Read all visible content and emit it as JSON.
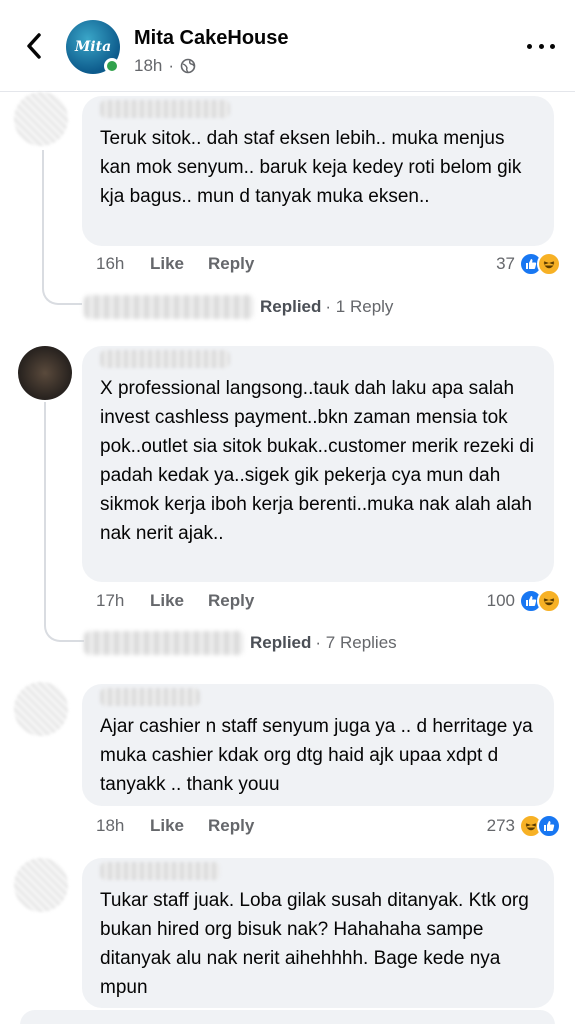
{
  "header": {
    "page_name": "Mita CakeHouse",
    "time": "18h",
    "logo_text": "Mita"
  },
  "comments": [
    {
      "text": "Teruk sitok.. dah staf eksen lebih.. muka menjus kan mok senyum.. baruk keja kedey roti belom gik kja bagus.. mun d tanyak muka eksen..",
      "time": "16h",
      "like": "Like",
      "reply": "Reply",
      "reactions": "37",
      "reaction_icons": [
        "like-icon",
        "haha-icon"
      ],
      "replied_label": "Replied",
      "replied_count": "· 1 Reply"
    },
    {
      "text": "X professional langsong..tauk dah laku apa salah invest cashless payment..bkn zaman mensia tok pok..outlet sia sitok bukak..customer merik rezeki di padah kedak ya..sigek gik pekerja cya mun dah sikmok kerja iboh kerja berenti..muka nak alah alah nak nerit ajak..",
      "time": "17h",
      "like": "Like",
      "reply": "Reply",
      "reactions": "100",
      "reaction_icons": [
        "like-icon",
        "haha-icon"
      ],
      "replied_label": "Replied",
      "replied_count": "· 7 Replies"
    },
    {
      "text": "Ajar cashier n staff senyum juga ya .. d herritage ya muka cashier kdak org dtg haid ajk upaa xdpt d tanyakk .. thank youu",
      "time": "18h",
      "like": "Like",
      "reply": "Reply",
      "reactions": "273",
      "reaction_icons": [
        "haha-icon",
        "like-icon"
      ]
    },
    {
      "text": "Tukar staff juak. Loba gilak susah ditanyak. Ktk org bukan hired org bisuk nak? Hahahaha sampe ditanyak alu nak nerit aihehhhh. Bage kede nya mpun"
    }
  ],
  "colors": {
    "bubble": "#f0f2f5",
    "meta_text": "#65676b",
    "like_blue": "#1877f2",
    "haha_yellow": "#f7b125",
    "online_green": "#31a24c"
  }
}
